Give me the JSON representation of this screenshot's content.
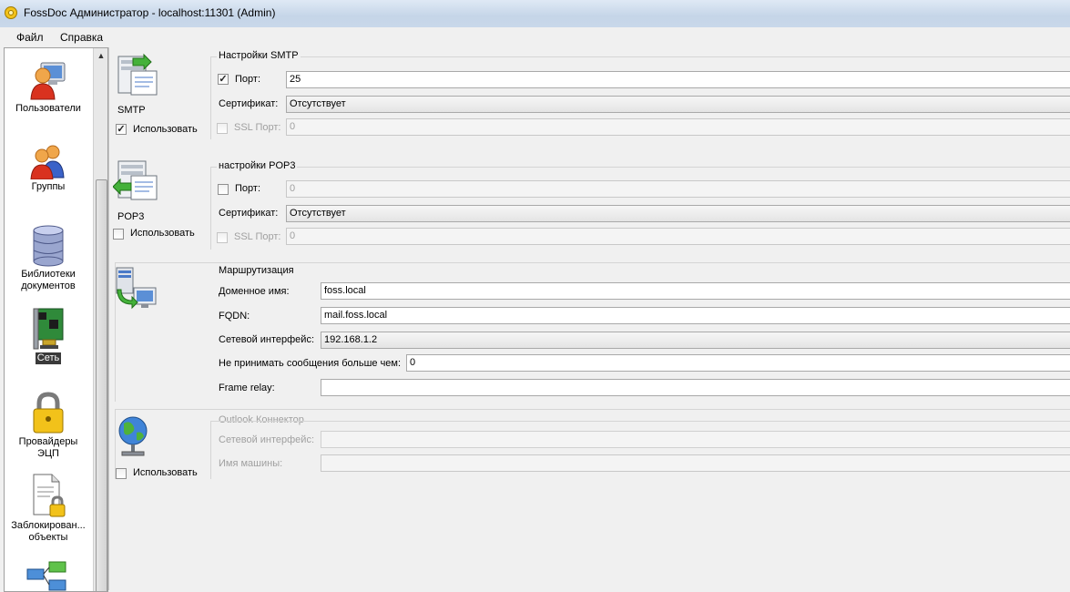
{
  "window": {
    "title": "FossDoc Администратор - localhost:11301 (Admin)"
  },
  "menu": {
    "file": "Файл",
    "help": "Справка"
  },
  "sidebar": {
    "items": [
      {
        "label": "Пользователи",
        "icon": "users-icon"
      },
      {
        "label": "Группы",
        "icon": "groups-icon"
      },
      {
        "label": "Библиотеки документов",
        "icon": "database-icon"
      },
      {
        "label": "Сеть",
        "icon": "network-card-icon",
        "selected": true
      },
      {
        "label": "Провайдеры ЭЦП",
        "icon": "padlock-icon"
      },
      {
        "label": "Заблокирован... объекты",
        "icon": "locked-document-icon"
      },
      {
        "label": "",
        "icon": "workflow-icon"
      }
    ]
  },
  "smtp": {
    "section_label": "SMTP",
    "use_label": "Использовать",
    "use_checked": true,
    "group_title": "Настройки SMTP",
    "port_label": "Порт:",
    "port_checked": true,
    "port_value": "25",
    "cert_label": "Сертификат:",
    "cert_value": "Отсутствует",
    "ssl_label": "SSL Порт:",
    "ssl_checked": false,
    "ssl_value": "0"
  },
  "pop3": {
    "section_label": "POP3",
    "use_label": "Использовать",
    "use_checked": false,
    "group_title": "настройки POP3",
    "port_label": "Порт:",
    "port_checked": false,
    "port_value": "0",
    "cert_label": "Сертификат:",
    "cert_value": "Отсутствует",
    "ssl_label": "SSL Порт:",
    "ssl_checked": false,
    "ssl_value": "0"
  },
  "routing": {
    "group_title": "Маршрутизация",
    "domain_label": "Доменное имя:",
    "domain_value": "foss.local",
    "fqdn_label": "FQDN:",
    "fqdn_value": "mail.foss.local",
    "iface_label": "Сетевой интерфейс:",
    "iface_value": "192.168.1.2",
    "maxmsg_label": "Не принимать сообщения больше чем:",
    "maxmsg_value": "0",
    "relay_label": "Frame relay:",
    "relay_value": ""
  },
  "outlook": {
    "use_label": "Использовать",
    "use_checked": false,
    "group_title": "Outlook Коннектор",
    "iface_label": "Сетевой интерфейс:",
    "iface_value": "",
    "machine_label": "Имя машины:",
    "machine_value": ""
  }
}
